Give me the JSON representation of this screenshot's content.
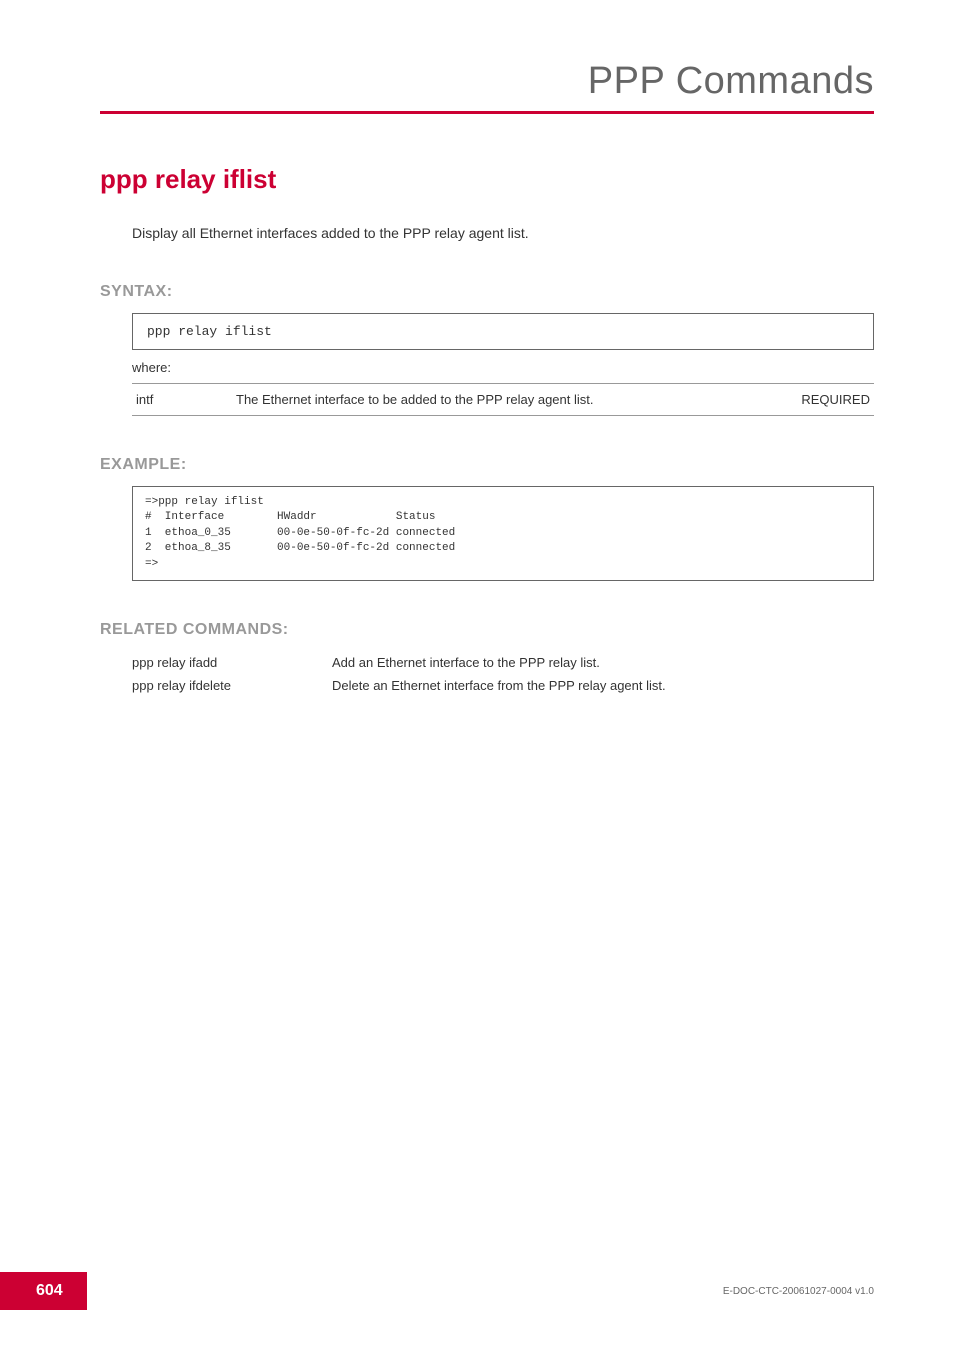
{
  "header": {
    "title": "PPP Commands"
  },
  "command": {
    "title": "ppp relay iflist",
    "description": "Display all Ethernet interfaces added to the PPP relay agent list."
  },
  "syntax": {
    "label": "SYNTAX:",
    "command": "ppp relay iflist",
    "where": "where:",
    "params": [
      {
        "name": "intf",
        "description": "The Ethernet interface to be added to the PPP relay agent list.",
        "required": "REQUIRED"
      }
    ]
  },
  "example": {
    "label": "EXAMPLE:",
    "content": "=>ppp relay iflist\n#  Interface        HWaddr            Status\n1  ethoa_0_35       00-0e-50-0f-fc-2d connected\n2  ethoa_8_35       00-0e-50-0f-fc-2d connected\n=>"
  },
  "related": {
    "label": "RELATED COMMANDS:",
    "commands": [
      {
        "name": "ppp relay ifadd",
        "description": "Add an Ethernet interface to the PPP relay list."
      },
      {
        "name": "ppp relay ifdelete",
        "description": "Delete an Ethernet interface from the PPP relay agent list."
      }
    ]
  },
  "footer": {
    "page": "604",
    "docref": "E-DOC-CTC-20061027-0004 v1.0"
  }
}
